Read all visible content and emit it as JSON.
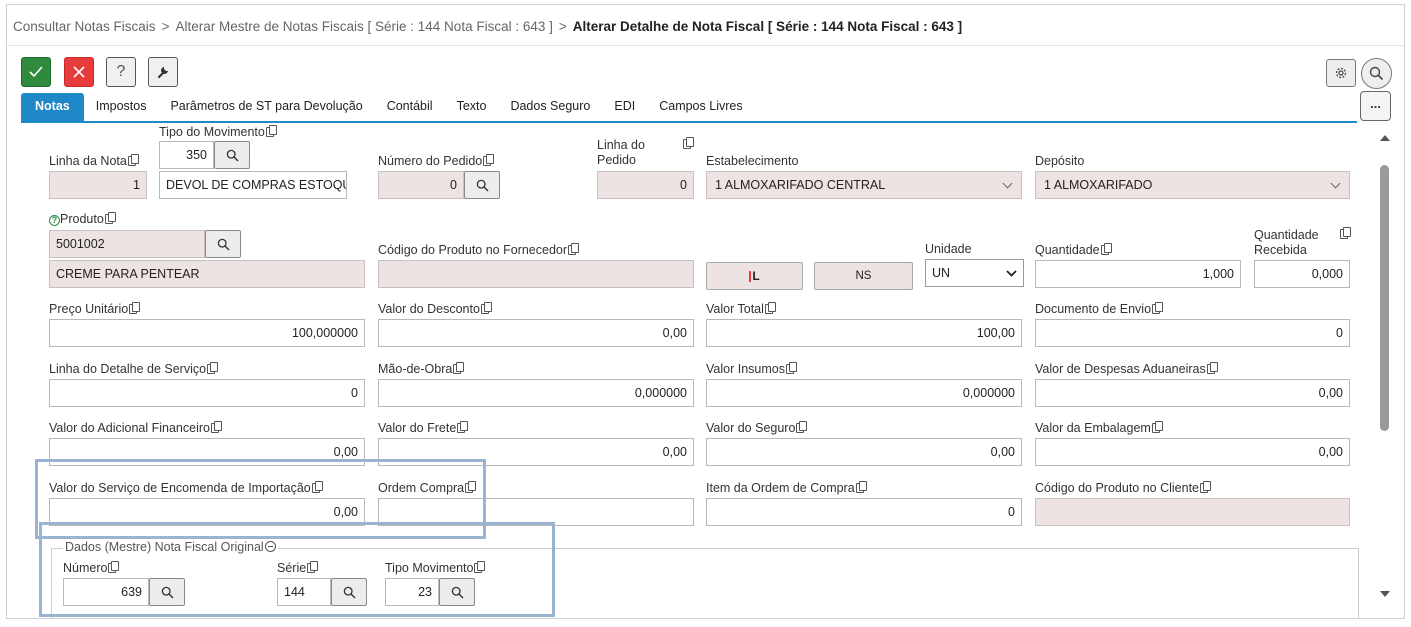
{
  "breadcrumb": {
    "item1": "Consultar Notas Fiscais",
    "item2": "Alterar Mestre de Notas Fiscais [ Série : 144 Nota Fiscal : 643 ]",
    "current": "Alterar Detalhe de Nota Fiscal [ Série : 144 Nota Fiscal : 643 ]",
    "sep": ">"
  },
  "toolbar": {
    "help": "?",
    "more": "..."
  },
  "tabs": [
    "Notas",
    "Impostos",
    "Parâmetros de ST para Devolução",
    "Contábil",
    "Texto",
    "Dados Seguro",
    "EDI",
    "Campos Livres"
  ],
  "form": {
    "linha_nota": {
      "label": "Linha da Nota",
      "value": "1"
    },
    "tipo_movimento": {
      "label": "Tipo do Movimento",
      "code": "350",
      "desc": "DEVOL DE COMPRAS ESTOQUE"
    },
    "numero_pedido": {
      "label": "Número do Pedido",
      "value": "0"
    },
    "linha_pedido": {
      "label1": "Linha do",
      "label2": "Pedido",
      "value": "0"
    },
    "estabelecimento": {
      "label": "Estabelecimento",
      "value": "1 ALMOXARIFADO CENTRAL"
    },
    "deposito": {
      "label": "Depósito",
      "value": "1 ALMOXARIFADO"
    },
    "produto": {
      "label": "Produto",
      "code": "5001002",
      "desc": "CREME PARA PENTEAR"
    },
    "codigo_fornecedor": {
      "label": "Código do Produto no Fornecedor",
      "value": ""
    },
    "btn_l": "L",
    "btn_ns": "NS",
    "unidade": {
      "label": "Unidade",
      "value": "UN"
    },
    "quantidade": {
      "label": "Quantidade",
      "value": "1,000"
    },
    "quantidade_recebida": {
      "label1": "Quantidade",
      "label2": "Recebida",
      "value": "0,000"
    },
    "preco_unitario": {
      "label": "Preço Unitário",
      "value": "100,000000"
    },
    "valor_desconto": {
      "label": "Valor do Desconto",
      "value": "0,00"
    },
    "valor_total": {
      "label": "Valor Total",
      "value": "100,00"
    },
    "documento_envio": {
      "label": "Documento de Envio",
      "value": "0"
    },
    "linha_detalhe_servico": {
      "label": "Linha do Detalhe de Serviço",
      "value": "0"
    },
    "mao_obra": {
      "label": "Mão-de-Obra",
      "value": "0,000000"
    },
    "valor_insumos": {
      "label": "Valor Insumos",
      "value": "0,000000"
    },
    "valor_despesas_aduaneiras": {
      "label": "Valor de Despesas Aduaneiras",
      "value": "0,00"
    },
    "valor_adicional_financeiro": {
      "label": "Valor do Adicional Financeiro",
      "value": "0,00"
    },
    "valor_frete": {
      "label": "Valor do Frete",
      "value": "0,00"
    },
    "valor_seguro": {
      "label": "Valor do Seguro",
      "value": "0,00"
    },
    "valor_embalagem": {
      "label": "Valor da Embalagem",
      "value": "0,00"
    },
    "valor_servico_encomenda": {
      "label": "Valor do Serviço de Encomenda de Importação",
      "value": "0,00"
    },
    "ordem_compra": {
      "label": "Ordem Compra",
      "value": ""
    },
    "item_ordem_compra": {
      "label": "Item da Ordem de Compra",
      "value": "0"
    },
    "codigo_produto_cliente": {
      "label": "Código do Produto no Cliente",
      "value": ""
    }
  },
  "nota_original": {
    "legend": "Dados (Mestre) Nota Fiscal Original",
    "numero": {
      "label": "Número",
      "value": "639"
    },
    "serie": {
      "label": "Série",
      "value": "144"
    },
    "tipo_movimento": {
      "label": "Tipo Movimento",
      "value": "23"
    }
  },
  "colors": {
    "accent": "#1e88c9",
    "ok": "#2f8a3d",
    "cancel": "#e63c3c",
    "readonly": "#ede3e3",
    "highlight": "#9ab3d0"
  }
}
